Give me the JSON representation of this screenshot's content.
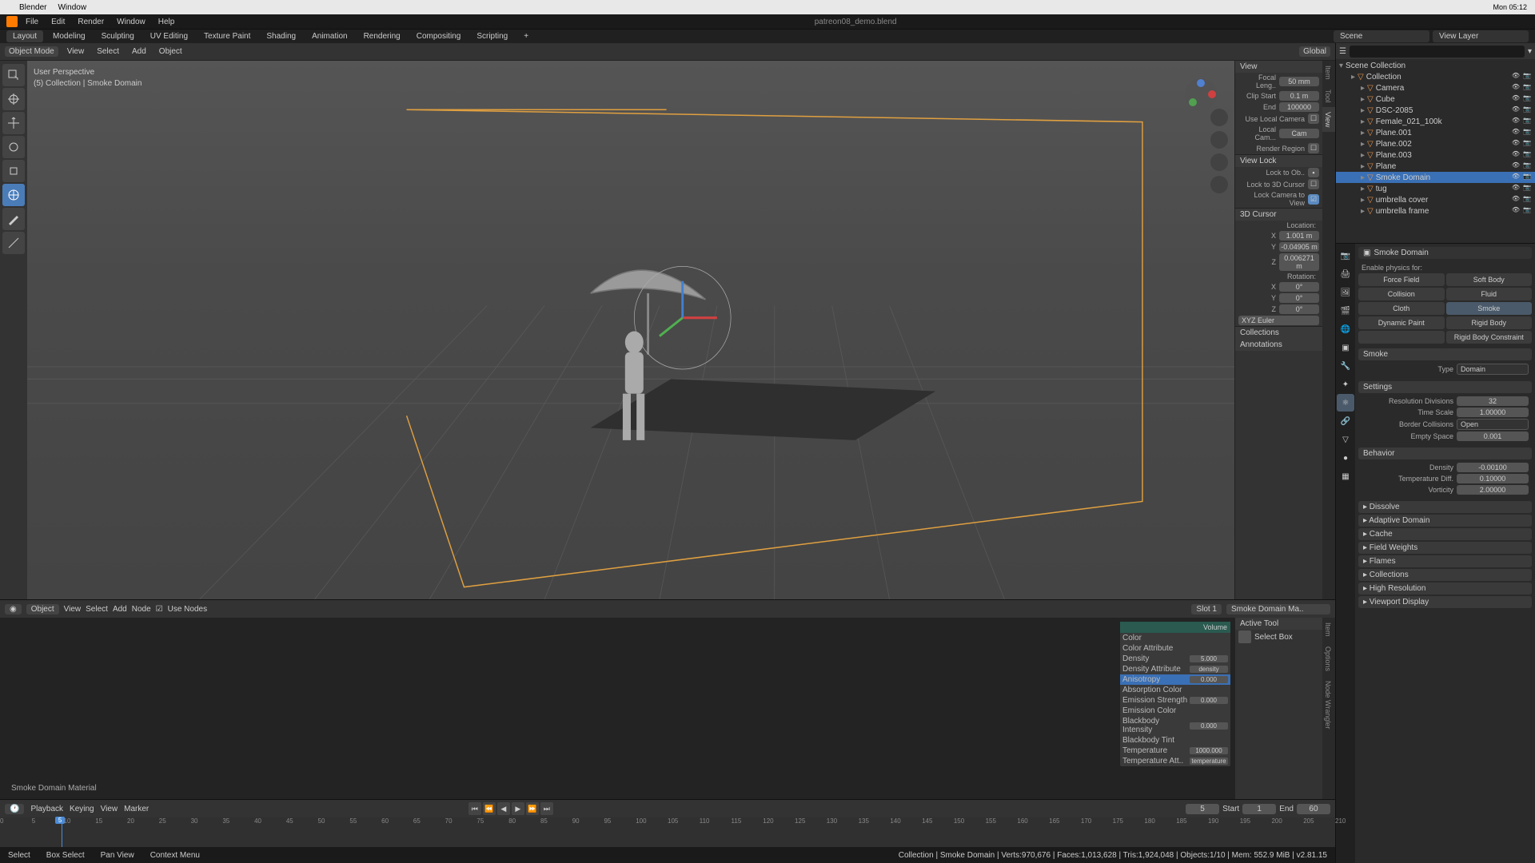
{
  "mac": {
    "app": "Blender",
    "window": "Window",
    "clock": "Mon 05:12"
  },
  "menu": {
    "file": "File",
    "edit": "Edit",
    "render": "Render",
    "window": "Window",
    "help": "Help"
  },
  "workspaces": [
    "Layout",
    "Modeling",
    "Sculpting",
    "UV Editing",
    "Texture Paint",
    "Shading",
    "Animation",
    "Rendering",
    "Compositing",
    "Scripting",
    "+"
  ],
  "ws_active": 0,
  "top_file": "patreon08_demo.blend",
  "scene_label": "Scene",
  "layer_label": "View Layer",
  "vp_header": {
    "mode": "Object Mode",
    "view": "View",
    "select": "Select",
    "add": "Add",
    "object": "Object",
    "orient": "Global"
  },
  "persp": {
    "l1": "User Perspective",
    "l2": "(5) Collection | Smoke Domain"
  },
  "npanel": {
    "view": "View",
    "focal_l": "Focal Leng..",
    "focal_v": "50 mm",
    "clip_l": "Clip Start",
    "clip_v": "0.1 m",
    "end_l": "End",
    "end_v": "100000",
    "uselocal": "Use Local Camera",
    "localcam": "Local Cam...",
    "localcam_v": "Cam",
    "rregion": "Render Region",
    "vlock": "View Lock",
    "lockob": "Lock to Ob..",
    "lock3d": "Lock to 3D Cursor",
    "lockcam": "Lock Camera to View",
    "cursor": "3D Cursor",
    "loc": "Location:",
    "x": "X",
    "y": "Y",
    "z": "Z",
    "loc_x": "1.001 m",
    "loc_y": "-0.04905 m",
    "loc_z": "0.006271 m",
    "rot": "Rotation:",
    "rot_x": "0°",
    "rot_y": "0°",
    "rot_z": "0°",
    "euler": "XYZ Euler",
    "coll": "Collections",
    "ann": "Annotations"
  },
  "tabs_r": [
    "Item",
    "Tool",
    "View"
  ],
  "shader": {
    "obj": "Object",
    "view": "View",
    "select": "Select",
    "add": "Add",
    "node": "Node",
    "usenodes": "Use Nodes",
    "slot": "Slot 1",
    "mat": "Smoke Domain Ma..",
    "mat_label": "Smoke Domain Material",
    "node_title": "Volume",
    "rows": [
      {
        "l": "Color"
      },
      {
        "l": "Color Attribute"
      },
      {
        "l": "Density",
        "v": "5.000"
      },
      {
        "l": "Density Attribute",
        "v": "density"
      },
      {
        "l": "Anisotropy",
        "v": "0.000",
        "sel": true
      },
      {
        "l": "Absorption Color"
      },
      {
        "l": "Emission Strength",
        "v": "0.000"
      },
      {
        "l": "Emission Color"
      },
      {
        "l": "Blackbody Intensity",
        "v": "0.000"
      },
      {
        "l": "Blackbody Tint"
      },
      {
        "l": "Temperature",
        "v": "1000.000"
      },
      {
        "l": "Temperature Att..",
        "v": "temperature"
      }
    ],
    "active_tool": "Active Tool",
    "select_box": "Select Box",
    "side_tabs": [
      "Item",
      "Options",
      "Node Wrangler"
    ]
  },
  "timeline": {
    "playback": "Playback",
    "keying": "Keying",
    "view": "View",
    "marker": "Marker",
    "cur": "5",
    "start_l": "Start",
    "start": "1",
    "end_l": "End",
    "end": "60"
  },
  "status": {
    "select": "Select",
    "box": "Box Select",
    "pan": "Pan View",
    "ctx": "Context Menu",
    "right": "Collection | Smoke Domain | Verts:970,676 | Faces:1,013,628 | Tris:1,924,048 | Objects:1/10 | Mem: 552.9 MiB | v2.81.15"
  },
  "outliner": {
    "root": "Scene Collection",
    "items": [
      {
        "ind": 12,
        "name": "Collection",
        "type": "coll"
      },
      {
        "ind": 24,
        "name": "Camera",
        "type": "cam"
      },
      {
        "ind": 24,
        "name": "Cube",
        "type": "mesh",
        "dim": true
      },
      {
        "ind": 24,
        "name": "DSC-2085",
        "type": "mesh"
      },
      {
        "ind": 24,
        "name": "Female_021_100k",
        "type": "mesh"
      },
      {
        "ind": 24,
        "name": "Plane.001",
        "type": "mesh"
      },
      {
        "ind": 24,
        "name": "Plane.002",
        "type": "mesh",
        "dim": true
      },
      {
        "ind": 24,
        "name": "Plane.003",
        "type": "mesh"
      },
      {
        "ind": 24,
        "name": "Plane",
        "type": "mesh"
      },
      {
        "ind": 24,
        "name": "Smoke Domain",
        "type": "mesh",
        "sel": true
      },
      {
        "ind": 24,
        "name": "tug",
        "type": "mesh"
      },
      {
        "ind": 24,
        "name": "umbrella cover",
        "type": "mesh"
      },
      {
        "ind": 24,
        "name": "umbrella frame",
        "type": "mesh"
      }
    ]
  },
  "props": {
    "title": "Smoke Domain",
    "enable": "Enable physics for:",
    "physics": [
      {
        "l": "Force Field"
      },
      {
        "l": "Soft Body"
      },
      {
        "l": "Collision"
      },
      {
        "l": "Fluid"
      },
      {
        "l": "Cloth"
      },
      {
        "l": "Smoke",
        "active": true
      },
      {
        "l": "Dynamic Paint"
      },
      {
        "l": "Rigid Body"
      },
      {
        "l": "",
        "span": true
      },
      {
        "l": "Rigid Body Constraint"
      }
    ],
    "smoke": "Smoke",
    "type_l": "Type",
    "type_v": "Domain",
    "settings": "Settings",
    "res_l": "Resolution Divisions",
    "res_v": "32",
    "tscale_l": "Time Scale",
    "tscale_v": "1.00000",
    "bcoll_l": "Border Collisions",
    "bcoll_v": "Open",
    "espace_l": "Empty Space",
    "espace_v": "0.001",
    "behavior": "Behavior",
    "dens_l": "Density",
    "dens_v": "-0.00100",
    "tdiff_l": "Temperature Diff.",
    "tdiff_v": "0.10000",
    "vort_l": "Vorticity",
    "vort_v": "2.00000",
    "sections": [
      "Dissolve",
      "Adaptive Domain",
      "Cache",
      "Field Weights",
      "Flames",
      "Collections",
      "High Resolution",
      "Viewport Display"
    ]
  }
}
